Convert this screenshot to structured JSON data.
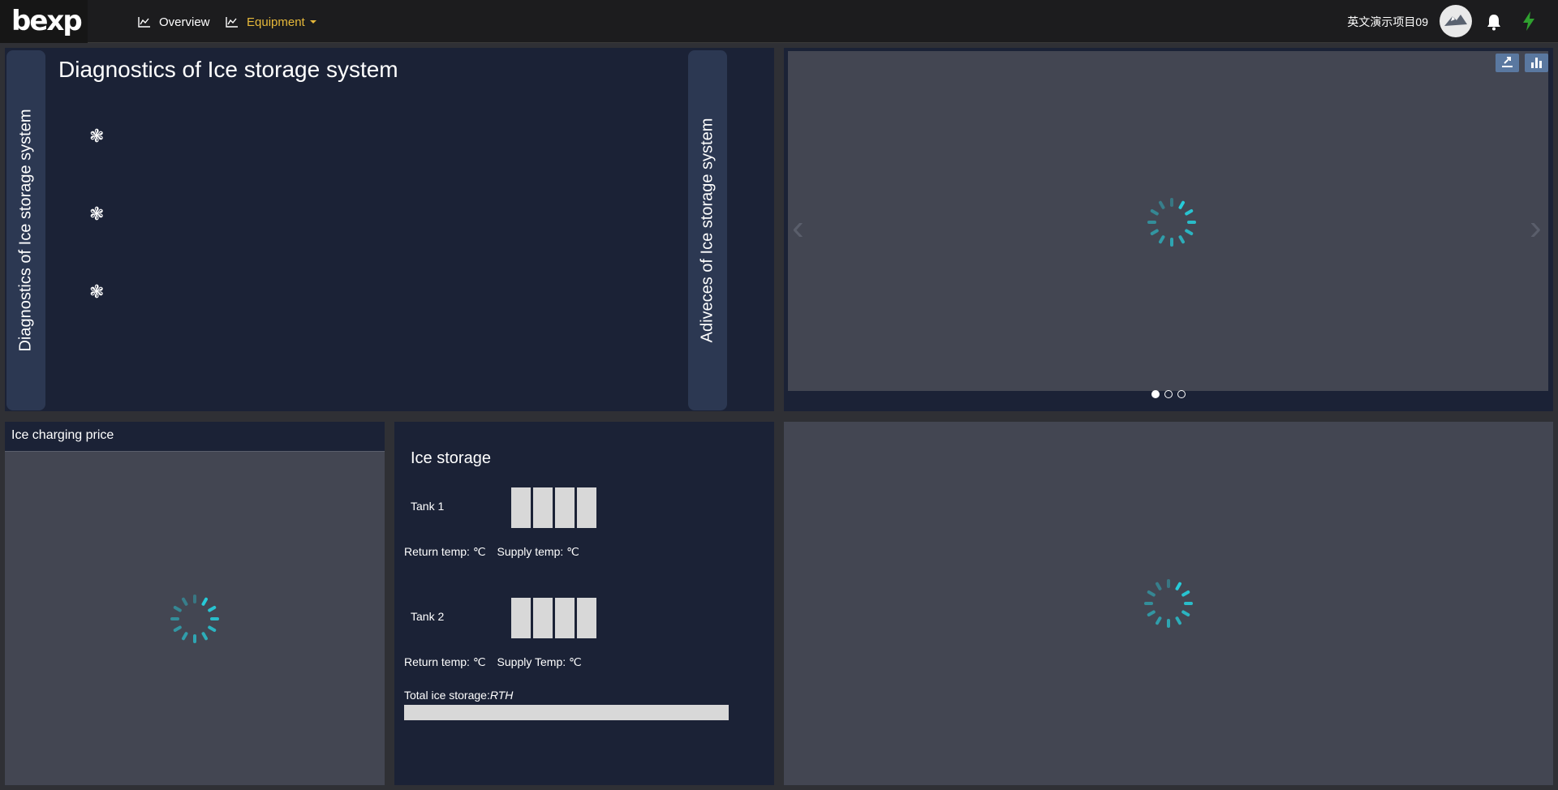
{
  "header": {
    "logo_text": "bexp",
    "nav": [
      {
        "label": "Overview",
        "icon": "line-chart-icon"
      },
      {
        "label": "Equipment",
        "icon": "line-chart-icon",
        "active": true
      }
    ],
    "project_name": "英文演示项目09"
  },
  "diagnostics": {
    "tab_left": "Diagnostics of Ice storage system",
    "title": "Diagnostics of Ice storage system",
    "items": [
      "❃",
      "❃",
      "❃"
    ],
    "tab_right": "Adiveces of Ice storage system"
  },
  "carousel": {
    "prev": "‹",
    "next": "›",
    "slide_count": 3,
    "active_slide": 1
  },
  "ice_price": {
    "title": "Ice charging price"
  },
  "ice_storage": {
    "title": "Ice storage",
    "tanks": [
      {
        "label": "Tank 1",
        "return_label": "Return temp: ℃",
        "supply_label": "Supply temp: ℃"
      },
      {
        "label": "Tank 2",
        "return_label": "Return temp: ℃",
        "supply_label": "Supply Temp: ℃"
      }
    ],
    "total_label": "Total ice storage:",
    "total_unit": "RTH"
  },
  "colors": {
    "accent": "#e6b83a",
    "spinner": "#25d3e0",
    "panel_dark": "#1b2236",
    "panel_gray": "#434652"
  }
}
